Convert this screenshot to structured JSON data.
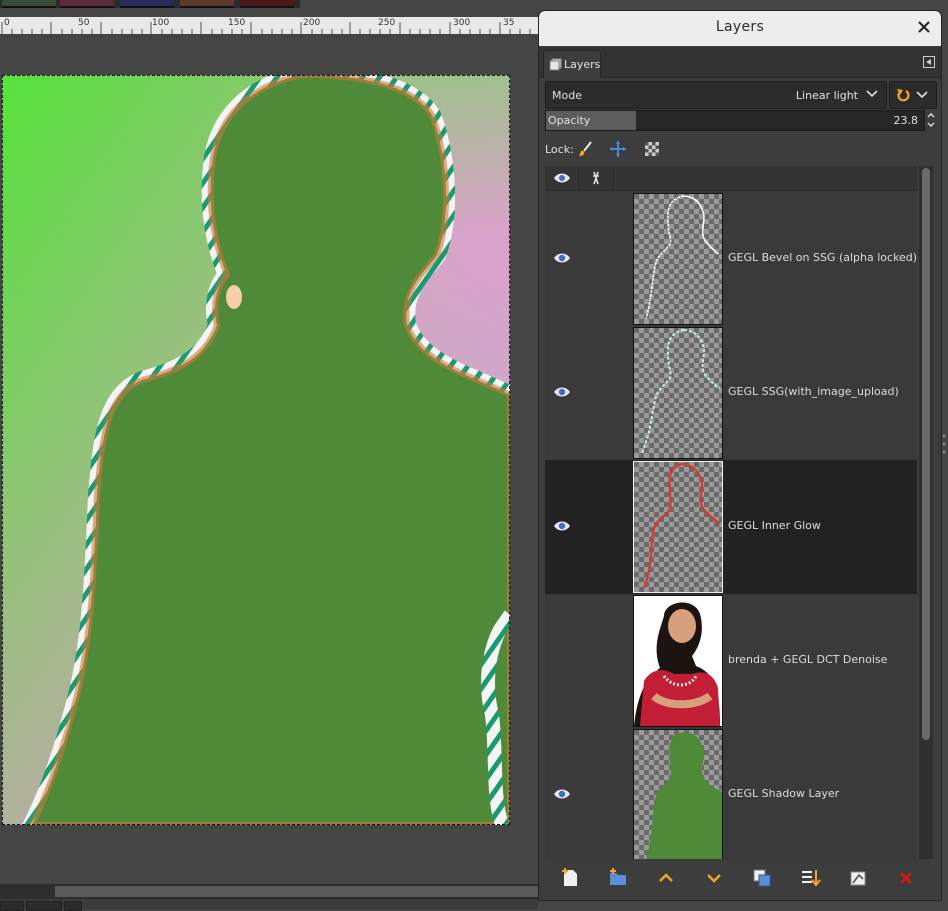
{
  "canvas": {
    "ruler_labels": [
      "0",
      "50",
      "100",
      "150",
      "200",
      "250",
      "300",
      "35"
    ]
  },
  "dialog": {
    "title": "Layers",
    "tab_label": "Layers",
    "mode": {
      "label": "Mode",
      "value": "Linear light"
    },
    "opacity": {
      "label": "Opacity",
      "value": "23.8",
      "level_percent": 23.8
    },
    "lock_label": "Lock:",
    "layers": [
      {
        "name": "GEGL Bevel on SSG (alpha locked)",
        "visible": true,
        "active": false
      },
      {
        "name": "GEGL SSG(with_image_upload)",
        "visible": true,
        "active": false
      },
      {
        "name": "GEGL Inner Glow",
        "visible": true,
        "active": true
      },
      {
        "name": "brenda + GEGL DCT Denoise",
        "visible": false,
        "active": false
      },
      {
        "name": "GEGL Shadow Layer",
        "visible": true,
        "active": false
      }
    ]
  },
  "colors": {
    "shadow_green": "#4e8a37",
    "accent_orange": "#f5a623",
    "delete_red": "#cc1a1a"
  }
}
